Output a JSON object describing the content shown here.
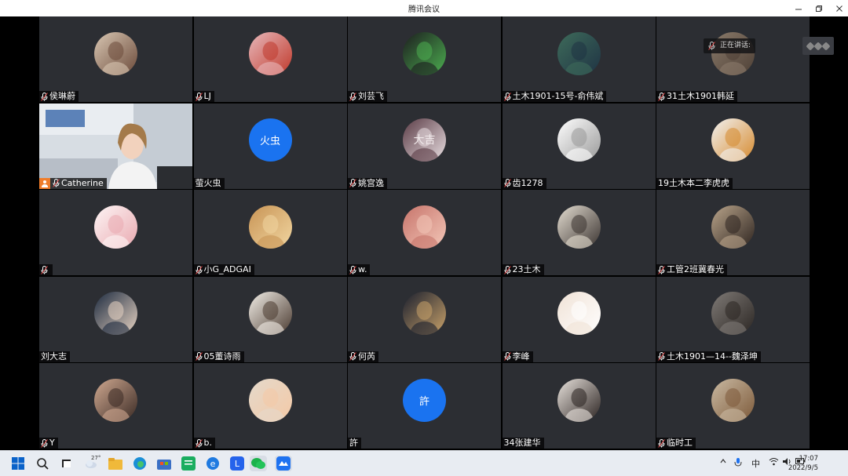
{
  "window": {
    "title": "腾讯会议"
  },
  "speaking_indicator": {
    "label": "正在讲话:"
  },
  "participants": [
    {
      "name": "侯琳蔚",
      "mic": true,
      "kind": "photo",
      "colors": [
        "#d9c7b3",
        "#6b4a3a"
      ]
    },
    {
      "name": "LJ",
      "mic": true,
      "kind": "photo",
      "colors": [
        "#e7b8bb",
        "#c0392b"
      ]
    },
    {
      "name": "刘芸飞",
      "mic": true,
      "kind": "photo",
      "colors": [
        "#1d1d1f",
        "#4caf50"
      ]
    },
    {
      "name": "土木1901-15号-俞伟斌",
      "mic": true,
      "kind": "photo",
      "colors": [
        "#3e6b5a",
        "#1f3344"
      ]
    },
    {
      "name": "31土木1901韩延",
      "mic": true,
      "kind": "photo",
      "colors": [
        "#8a7a6a",
        "#4e4036"
      ]
    },
    {
      "name": "Catherine",
      "mic": true,
      "kind": "video",
      "host": true,
      "colors": [
        "#cfd6dd",
        "#f2d2bd"
      ]
    },
    {
      "name": "萤火虫",
      "mic": false,
      "kind": "initial",
      "initial": "火虫"
    },
    {
      "name": "姚宫逸",
      "mic": true,
      "kind": "photo",
      "colors": [
        "#5a3b45",
        "#e9dfe2"
      ],
      "glyph": "大吉"
    },
    {
      "name": "齿1278",
      "mic": true,
      "kind": "photo",
      "colors": [
        "#ffffff",
        "#999999"
      ]
    },
    {
      "name": "19土木本二李虎虎",
      "mic": false,
      "kind": "photo",
      "colors": [
        "#f2f2f2",
        "#d68a2e"
      ]
    },
    {
      "name": "",
      "mic": true,
      "kind": "photo",
      "colors": [
        "#fdf5f5",
        "#e9a9b0"
      ]
    },
    {
      "name": "小G_ADGAI",
      "mic": true,
      "kind": "photo",
      "colors": [
        "#c89455",
        "#f1d6a1"
      ]
    },
    {
      "name": "w.",
      "mic": true,
      "kind": "photo",
      "colors": [
        "#c7746b",
        "#f3c7b8"
      ]
    },
    {
      "name": "23土木",
      "mic": true,
      "kind": "photo",
      "colors": [
        "#e4ddd1",
        "#3a3330"
      ]
    },
    {
      "name": "工管2班冀春光",
      "mic": true,
      "kind": "photo",
      "colors": [
        "#b9a48a",
        "#2d2420"
      ]
    },
    {
      "name": "刘大志",
      "mic": false,
      "kind": "photo",
      "colors": [
        "#1c2a3f",
        "#e7d3c2"
      ]
    },
    {
      "name": "05董诗雨",
      "mic": true,
      "kind": "photo",
      "colors": [
        "#f3efe8",
        "#4a3a30"
      ]
    },
    {
      "name": "何芮",
      "mic": true,
      "kind": "photo",
      "colors": [
        "#1a1f2e",
        "#c9a26a"
      ]
    },
    {
      "name": "李峰",
      "mic": true,
      "kind": "photo",
      "colors": [
        "#f0e2d6",
        "#ffffff"
      ]
    },
    {
      "name": "土木1901—14--魏泽坤",
      "mic": true,
      "kind": "photo",
      "colors": [
        "#7f7a76",
        "#2b2623"
      ]
    },
    {
      "name": "Y",
      "mic": true,
      "kind": "photo",
      "colors": [
        "#d0a991",
        "#3a2a24"
      ]
    },
    {
      "name": "b.",
      "mic": true,
      "kind": "photo",
      "colors": [
        "#e4d9cb",
        "#f4c9a6"
      ]
    },
    {
      "name": "許",
      "mic": false,
      "kind": "initial",
      "initial": "許"
    },
    {
      "name": "34张建华",
      "mic": false,
      "kind": "photo",
      "colors": [
        "#e9e3dd",
        "#2a2220"
      ]
    },
    {
      "name": "临时工",
      "mic": true,
      "kind": "photo",
      "colors": [
        "#c9b9a2",
        "#7d5a3a"
      ]
    }
  ],
  "taskbar": {
    "weather_temp": "27°",
    "ime": "中",
    "time": "17:07",
    "date": "2022/9/5"
  },
  "colors": {
    "tile_bg": "#2c2e33",
    "initial_avatar": "#1a73f0",
    "host_badge": "#f07d2a"
  }
}
